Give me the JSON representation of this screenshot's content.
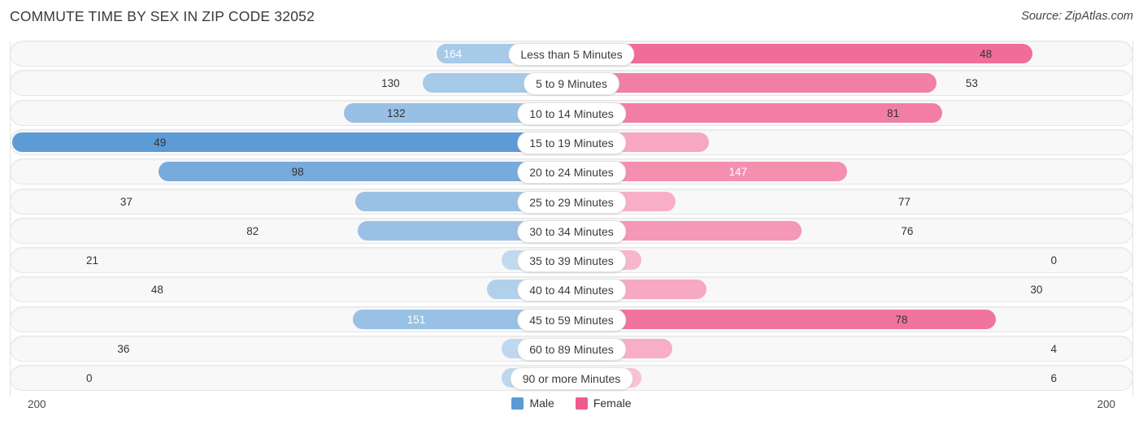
{
  "header": {
    "title": "COMMUTE TIME BY SEX IN ZIP CODE 32052",
    "source": "Source: ZipAtlas.com"
  },
  "legend": {
    "male_label": "Male",
    "female_label": "Female",
    "male_color": "#5b9bd5",
    "female_color": "#ef5b8c"
  },
  "axis": {
    "left_label": "200",
    "right_label": "200"
  },
  "chart_data": {
    "type": "bar",
    "title": "COMMUTE TIME BY SEX IN ZIP CODE 32052",
    "orientation": "horizontal-diverging",
    "xlabel": "",
    "ylabel": "",
    "xlim": [
      200,
      200
    ],
    "axis_max": 200,
    "grid": true,
    "legend_position": "bottom-center",
    "categories": [
      "Less than 5 Minutes",
      "5 to 9 Minutes",
      "10 to 14 Minutes",
      "15 to 19 Minutes",
      "20 to 24 Minutes",
      "25 to 29 Minutes",
      "30 to 34 Minutes",
      "35 to 39 Minutes",
      "40 to 44 Minutes",
      "45 to 59 Minutes",
      "60 to 89 Minutes",
      "90 or more Minutes"
    ],
    "series": [
      {
        "name": "Male",
        "color": "#5b9bd5",
        "values": [
          48,
          53,
          81,
          199,
          147,
          77,
          76,
          0,
          30,
          78,
          4,
          6
        ]
      },
      {
        "name": "Female",
        "color": "#ef5b8c",
        "values": [
          164,
          130,
          132,
          49,
          98,
          37,
          82,
          21,
          48,
          151,
          36,
          0
        ]
      }
    ]
  }
}
